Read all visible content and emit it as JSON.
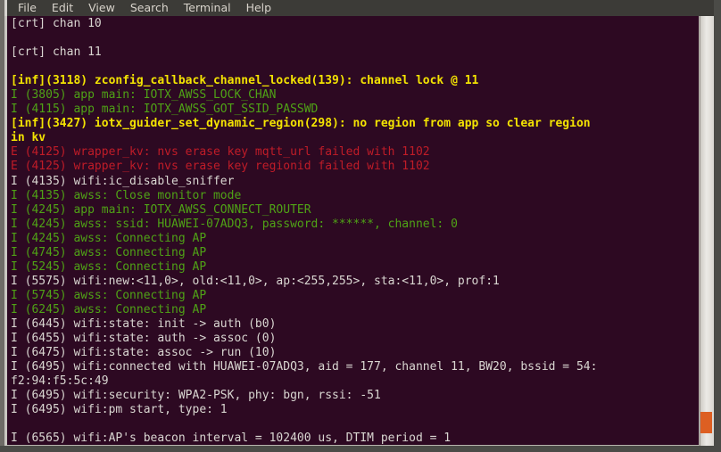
{
  "window": {
    "type": "terminal-emulator",
    "background_color": "#2d0922",
    "menubar_color": "#3c3b37",
    "scrollbar_thumb_color": "#dd5f22"
  },
  "menubar": {
    "items": [
      {
        "label": "File"
      },
      {
        "label": "Edit"
      },
      {
        "label": "View"
      },
      {
        "label": "Search"
      },
      {
        "label": "Terminal"
      },
      {
        "label": "Help"
      }
    ]
  },
  "terminal": {
    "lines": [
      {
        "text": "[crt] chan 10",
        "color": "white"
      },
      {
        "text": "",
        "color": "white"
      },
      {
        "text": "[crt] chan 11",
        "color": "white"
      },
      {
        "text": "",
        "color": "white"
      },
      {
        "text": "[inf](3118) zconfig_callback_channel_locked(139): channel lock @ 11",
        "color": "yellow"
      },
      {
        "text": "I (3805) app main: IOTX_AWSS_LOCK_CHAN",
        "color": "green"
      },
      {
        "text": "I (4115) app main: IOTX_AWSS_GOT_SSID_PASSWD",
        "color": "green"
      },
      {
        "text": "[inf](3427) iotx_guider_set_dynamic_region(298): no region from app so clear region",
        "color": "yellow"
      },
      {
        "text": "in kv",
        "color": "yellow"
      },
      {
        "text": "E (4125) wrapper_kv: nvs erase key mqtt_url failed with 1102",
        "color": "red"
      },
      {
        "text": "E (4125) wrapper_kv: nvs erase key regionid failed with 1102",
        "color": "red"
      },
      {
        "text": "I (4135) wifi:ic_disable_sniffer",
        "color": "white"
      },
      {
        "text": "I (4135) awss: Close monitor mode",
        "color": "green"
      },
      {
        "text": "I (4245) app main: IOTX_AWSS_CONNECT_ROUTER",
        "color": "green"
      },
      {
        "text": "I (4245) awss: ssid: HUAWEI-07ADQ3, password: ******, channel: 0",
        "color": "green"
      },
      {
        "text": "I (4245) awss: Connecting AP",
        "color": "green"
      },
      {
        "text": "I (4745) awss: Connecting AP",
        "color": "green"
      },
      {
        "text": "I (5245) awss: Connecting AP",
        "color": "green"
      },
      {
        "text": "I (5575) wifi:new:<11,0>, old:<11,0>, ap:<255,255>, sta:<11,0>, prof:1",
        "color": "white"
      },
      {
        "text": "I (5745) awss: Connecting AP",
        "color": "green"
      },
      {
        "text": "I (6245) awss: Connecting AP",
        "color": "green"
      },
      {
        "text": "I (6445) wifi:state: init -> auth (b0)",
        "color": "white"
      },
      {
        "text": "I (6455) wifi:state: auth -> assoc (0)",
        "color": "white"
      },
      {
        "text": "I (6475) wifi:state: assoc -> run (10)",
        "color": "white"
      },
      {
        "text": "I (6495) wifi:connected with HUAWEI-07ADQ3, aid = 177, channel 11, BW20, bssid = 54:",
        "color": "white"
      },
      {
        "text": "f2:94:f5:5c:49",
        "color": "white"
      },
      {
        "text": "I (6495) wifi:security: WPA2-PSK, phy: bgn, rssi: -51",
        "color": "white"
      },
      {
        "text": "I (6495) wifi:pm start, type: 1",
        "color": "white"
      },
      {
        "text": "",
        "color": "white"
      },
      {
        "text": "I (6565) wifi:AP's beacon interval = 102400 us, DTIM period = 1",
        "color": "white"
      }
    ]
  }
}
